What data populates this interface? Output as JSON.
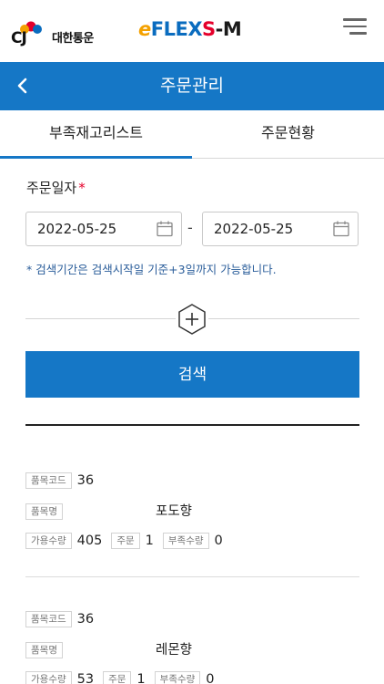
{
  "header": {
    "company_mark": "CJ",
    "company_name": "대한통운",
    "brand": {
      "e": "e",
      "flex": "FLEX",
      "s": "S",
      "m": "-M"
    }
  },
  "title_bar": {
    "title": "주문관리"
  },
  "tabs": [
    {
      "label": "부족재고리스트",
      "active": true
    },
    {
      "label": "주문현황",
      "active": false
    }
  ],
  "search": {
    "order_date_label": "주문일자",
    "required_mark": "*",
    "start_date": "2022-05-25",
    "end_date": "2022-05-25",
    "date_separator": "-",
    "notice": "* 검색기간은 검색시작일 기준+3일까지 가능합니다.",
    "search_button": "검색"
  },
  "labels": {
    "item_code": "품목코드",
    "item_name": "품목명",
    "available_qty": "가용수량",
    "order": "주문",
    "shortage_qty": "부족수량"
  },
  "items": [
    {
      "code": "36",
      "name": "포도향",
      "available": "405",
      "order": "1",
      "shortage": "0"
    },
    {
      "code": "36",
      "name": "레몬향",
      "available": "53",
      "order": "1",
      "shortage": "0"
    }
  ],
  "colors": {
    "primary": "#1577c6",
    "required": "#e5002b",
    "notice": "#2a5d9a"
  }
}
